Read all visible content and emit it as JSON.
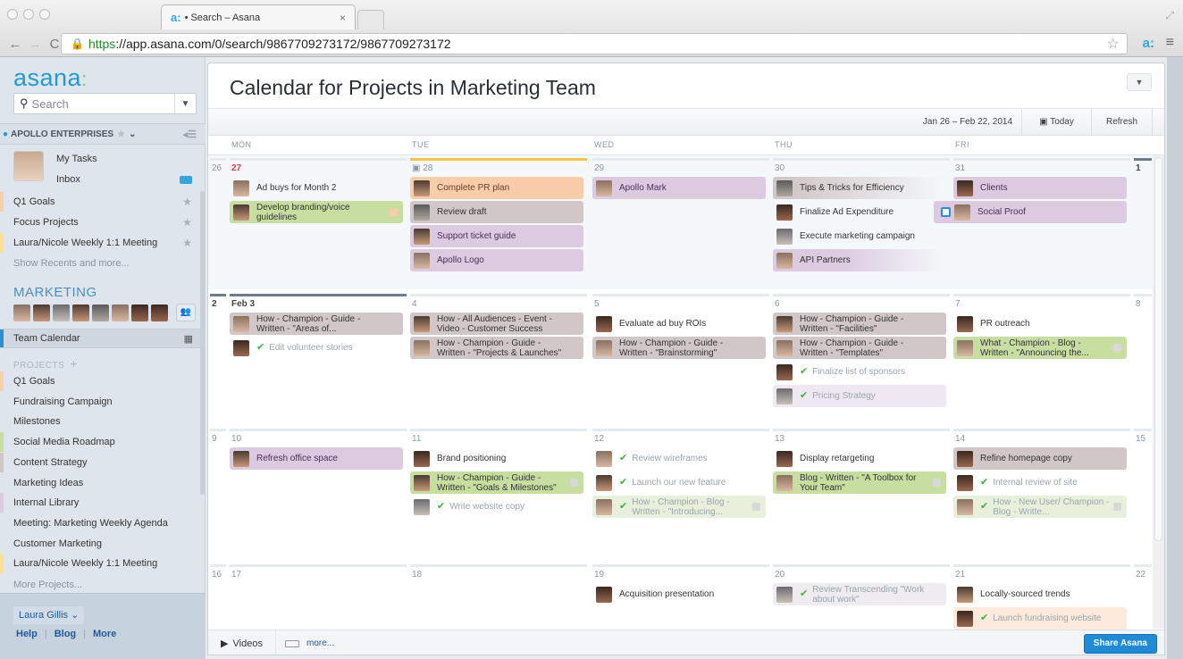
{
  "browser": {
    "tab_title": "• Search – Asana",
    "tab_favicon": "asana-favicon",
    "url_scheme": "https",
    "url_rest": "://app.asana.com/0/search/9867709273172/9867709273172",
    "icons": [
      "back-icon",
      "forward-icon",
      "reload-icon",
      "lock-icon",
      "bookmark-star-icon",
      "asana-extension-icon",
      "menu-icon"
    ]
  },
  "sidebar": {
    "logo": "asana",
    "search_placeholder": "Search",
    "org_name": "APOLLO ENTERPRISES",
    "my_tasks": "My Tasks",
    "inbox": "Inbox",
    "favorites": [
      {
        "label": "Q1 Goals",
        "color": "#f9cda8"
      },
      {
        "label": "Focus Projects",
        "color": ""
      },
      {
        "label": "Laura/Nicole Weekly 1:1 Meeting",
        "color": "#fbe38e"
      }
    ],
    "show_recents": "Show Recents and more...",
    "team_name": "MARKETING",
    "team_calendar": "Team Calendar",
    "projects_header": "PROJECTS",
    "projects": [
      {
        "label": "Q1 Goals",
        "color": "#f9cda8"
      },
      {
        "label": "Fundraising Campaign",
        "color": ""
      },
      {
        "label": "Milestones",
        "color": ""
      },
      {
        "label": "Social Media Roadmap",
        "color": "#c8dea0"
      },
      {
        "label": "Content Strategy",
        "color": "#d2c7c8"
      },
      {
        "label": "Marketing Ideas",
        "color": ""
      },
      {
        "label": "Internal Library",
        "color": "#dccbe0"
      },
      {
        "label": "Meeting: Marketing Weekly Agenda",
        "color": ""
      },
      {
        "label": "Customer Marketing",
        "color": ""
      },
      {
        "label": "Laura/Nicole Weekly 1:1 Meeting",
        "color": "#fbe38e"
      }
    ],
    "more_projects": "More Projects...",
    "user": "Laura Gillis",
    "footer_links": [
      "Help",
      "Blog",
      "More"
    ]
  },
  "main": {
    "title": "Calendar for Projects in Marketing Team",
    "range": "Jan 26 – Feb 22, 2014",
    "today": "Today",
    "refresh": "Refresh",
    "weekdays": [
      "MON",
      "TUE",
      "WED",
      "THU",
      "FRI"
    ],
    "weeks": [
      {
        "sun": "26",
        "sat": "1",
        "days": [
          {
            "num": "27",
            "style": "red",
            "tasks": [
              {
                "name": "Ad buys for Month 2",
                "color": "",
                "av": "av1"
              },
              {
                "name": "Develop branding/voice guidelines",
                "color": "c-green",
                "av": "av2",
                "sq": "#f9cda8"
              }
            ]
          },
          {
            "num": "28",
            "style": "today",
            "tasks": [
              {
                "name": "Complete PR plan",
                "color": "c-orange",
                "av": "av2"
              },
              {
                "name": "Review draft",
                "color": "c-grey",
                "av": "av3"
              },
              {
                "name": "Support ticket guide",
                "color": "c-purple",
                "av": "av2"
              },
              {
                "name": "Apollo Logo",
                "color": "c-purple",
                "av": "av1"
              }
            ]
          },
          {
            "num": "29",
            "tasks": [
              {
                "name": "Apollo Mark",
                "color": "c-purple",
                "av": "av1"
              }
            ]
          },
          {
            "num": "30",
            "tasks": [
              {
                "name": "Tips & Tricks for Efficiency",
                "color": "fade-grey",
                "av": "av3"
              },
              {
                "name": "Finalize Ad Expenditure",
                "color": "",
                "av": "av4"
              },
              {
                "name": "Execute marketing campaign",
                "color": "",
                "av": "av5"
              },
              {
                "name": "API Partners",
                "color": "fade",
                "av": "av1"
              }
            ]
          },
          {
            "num": "31",
            "tasks": [
              {
                "name": "Clients",
                "color": "c-purple",
                "av": "av4"
              },
              {
                "name": "Social Proof",
                "color": "c-purple",
                "av": "av1",
                "dragging": true
              }
            ]
          }
        ]
      },
      {
        "sun": "2",
        "sat": "8",
        "days": [
          {
            "num": "Feb 3",
            "style": "bold",
            "tasks": [
              {
                "name": "How - Champion - Guide - Written - \"Areas of...",
                "color": "c-grey",
                "av": "av1"
              },
              {
                "name": "Edit volunteer stories",
                "color": "",
                "av": "av4",
                "done": true
              }
            ]
          },
          {
            "num": "4",
            "tasks": [
              {
                "name": "How - All Audiences - Event - Video - Customer Success",
                "color": "c-grey",
                "av": "av2"
              },
              {
                "name": "How - Champion - Guide - Written - \"Projects & Launches\"",
                "color": "c-grey",
                "av": "av1"
              }
            ]
          },
          {
            "num": "5",
            "tasks": [
              {
                "name": "Evaluate ad buy ROIs",
                "color": "",
                "av": "av4"
              },
              {
                "name": "How - Champion - Guide - Written - \"Brainstorming\"",
                "color": "c-grey",
                "av": "av1"
              }
            ]
          },
          {
            "num": "6",
            "tasks": [
              {
                "name": "How - Champion - Guide - Written - \"Facilities\"",
                "color": "c-grey",
                "av": "av2"
              },
              {
                "name": "How - Champion - Guide - Written - \"Templates\"",
                "color": "c-grey",
                "av": "av1"
              },
              {
                "name": "Finalize list of sponsors",
                "color": "",
                "av": "av4",
                "done": true
              },
              {
                "name": "Pricing Strategy",
                "color": "c-lpurple",
                "av": "av5",
                "done": true
              }
            ]
          },
          {
            "num": "7",
            "tasks": [
              {
                "name": "PR outreach",
                "color": "",
                "av": "av4"
              },
              {
                "name": "What - Champion - Blog - Written - \"Announcing the...",
                "color": "c-green",
                "av": "av1",
                "sq": "#d8d8d8"
              }
            ]
          }
        ]
      },
      {
        "sun": "9",
        "sat": "15",
        "days": [
          {
            "num": "10",
            "tasks": [
              {
                "name": "Refresh office space",
                "color": "c-purple",
                "av": "av2"
              }
            ]
          },
          {
            "num": "11",
            "tasks": [
              {
                "name": "Brand positioning",
                "color": "",
                "av": "av4"
              },
              {
                "name": "How - Champion - Guide - Written - \"Goals & Milestones\"",
                "color": "c-green",
                "av": "av2",
                "sq": "#d8d8d8"
              },
              {
                "name": "Write website copy",
                "color": "",
                "av": "av5",
                "done": true
              }
            ]
          },
          {
            "num": "12",
            "tasks": [
              {
                "name": "Review wireframes",
                "color": "",
                "av": "av1",
                "done": true
              },
              {
                "name": "Launch our new feature",
                "color": "",
                "av": "av2",
                "done": true
              },
              {
                "name": "How - Champion - Blog - Written - \"Introducing...",
                "color": "c-lgreen",
                "av": "av1",
                "done": true,
                "sq": "#d8d8d8"
              }
            ]
          },
          {
            "num": "13",
            "tasks": [
              {
                "name": "Display retargeting",
                "color": "",
                "av": "av4"
              },
              {
                "name": "Blog - Written - \"A Toolbox for Your Team\"",
                "color": "c-green",
                "av": "av1",
                "sq": "#d8d8d8"
              }
            ]
          },
          {
            "num": "14",
            "tasks": [
              {
                "name": "Refine homepage copy",
                "color": "c-grey",
                "av": "av4"
              },
              {
                "name": "Internal review of site",
                "color": "",
                "av": "av4",
                "done": true
              },
              {
                "name": "How - New User/ Champion - Blog - Writte...",
                "color": "c-lgreen",
                "av": "av1",
                "done": true,
                "sq": "#d8d8d8"
              }
            ]
          }
        ]
      },
      {
        "sun": "16",
        "sat": "22",
        "days": [
          {
            "num": "17",
            "tasks": []
          },
          {
            "num": "18",
            "tasks": []
          },
          {
            "num": "19",
            "tasks": [
              {
                "name": "Acquisition presentation",
                "color": "",
                "av": "av4"
              }
            ]
          },
          {
            "num": "20",
            "tasks": [
              {
                "name": "Review Transcending \"Work about work\"",
                "color": "c-lgrey",
                "av": "av5",
                "done": true
              }
            ]
          },
          {
            "num": "21",
            "tasks": [
              {
                "name": "Locally-sourced trends",
                "color": "",
                "av": "av2"
              },
              {
                "name": "Launch fundraising website",
                "color": "c-lorange",
                "av": "av4",
                "done": true
              }
            ]
          }
        ]
      }
    ]
  },
  "footer": {
    "videos": "Videos",
    "more": "more...",
    "share": "Share Asana"
  }
}
